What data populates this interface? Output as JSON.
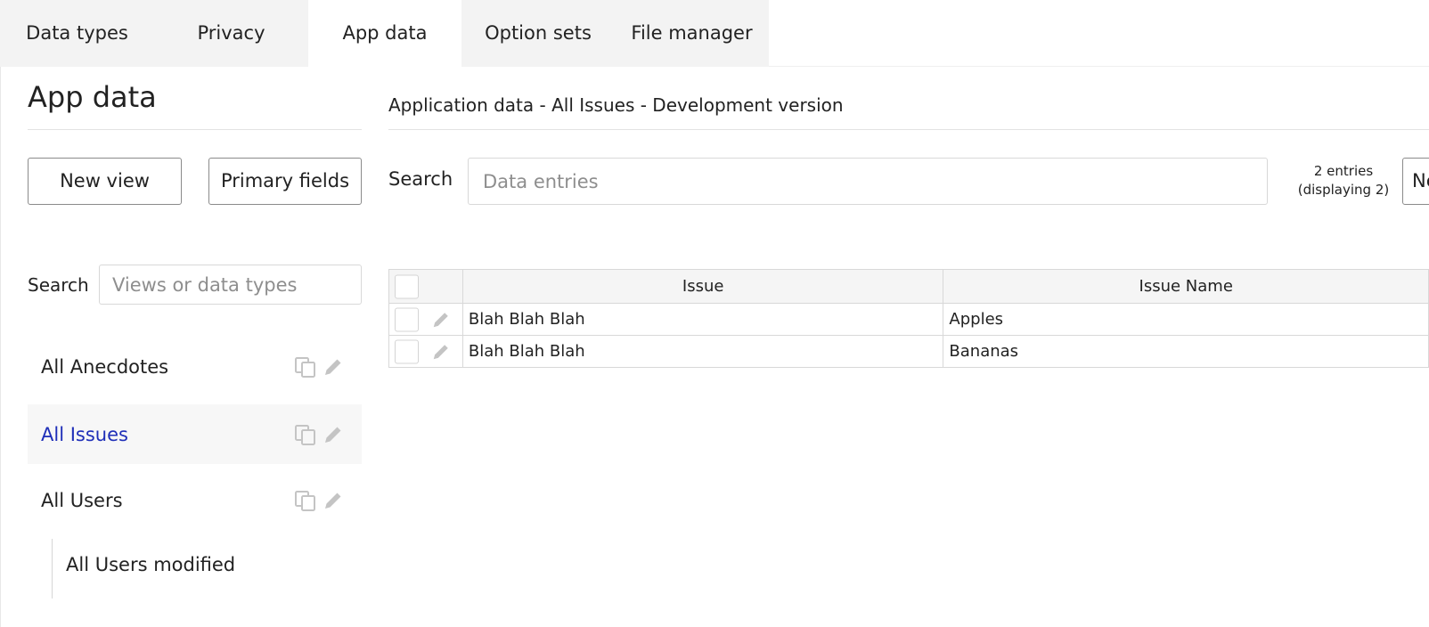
{
  "tabs": [
    {
      "label": "Data types"
    },
    {
      "label": "Privacy"
    },
    {
      "label": "App data"
    },
    {
      "label": "Option sets"
    },
    {
      "label": "File manager"
    }
  ],
  "sidebar": {
    "title": "App data",
    "new_view_label": "New view",
    "primary_fields_label": "Primary fields",
    "search_label": "Search",
    "search_placeholder": "Views or data types",
    "views": [
      {
        "label": "All Anecdotes"
      },
      {
        "label": "All Issues"
      },
      {
        "label": "All Users"
      }
    ],
    "sub_views": [
      {
        "label": "All Users modified"
      }
    ]
  },
  "main": {
    "title": "Application data - All Issues - Development version",
    "search_label": "Search",
    "search_placeholder": "Data entries",
    "entries_count": "2 entries (displaying 2)",
    "new_entry_label": "Ne",
    "table": {
      "columns": [
        "Issue",
        "Issue Name"
      ],
      "rows": [
        {
          "issue": "Blah Blah Blah",
          "issue_name": "Apples"
        },
        {
          "issue": "Blah Blah Blah",
          "issue_name": "Bananas"
        }
      ]
    }
  },
  "colors": {
    "selected_link": "#1f2fb8",
    "tab_bar_bg": "#f3f3f3",
    "icon_gray": "#c4c4c4"
  }
}
